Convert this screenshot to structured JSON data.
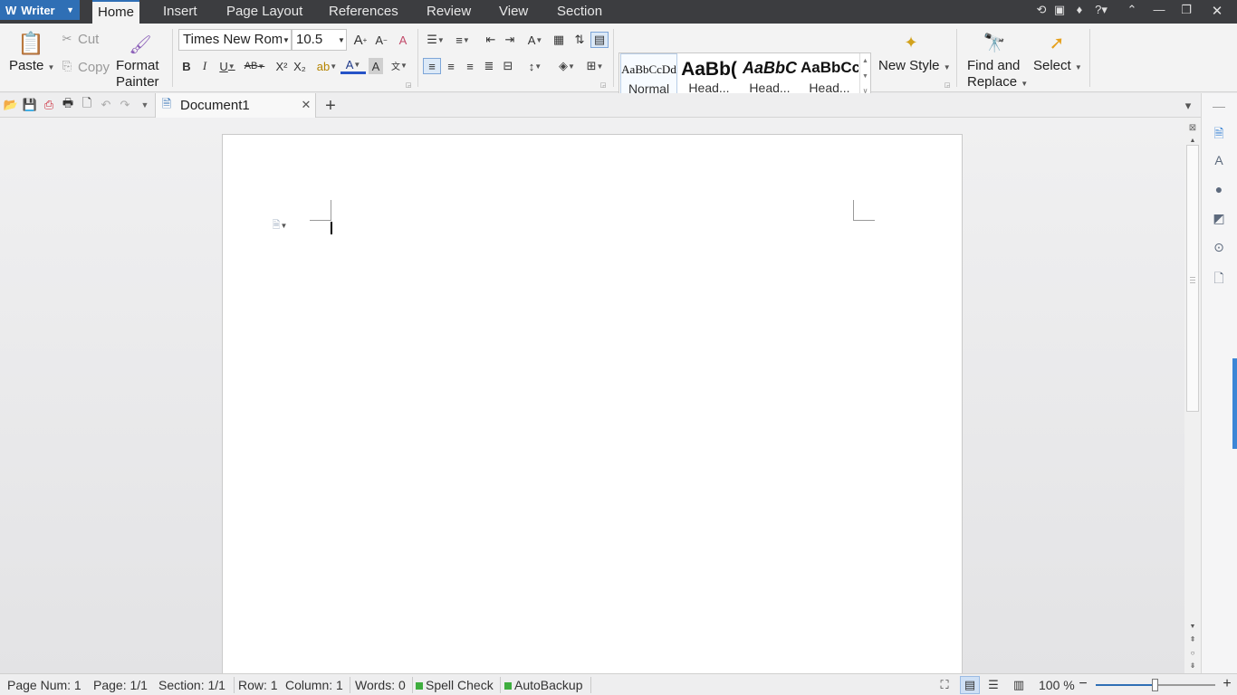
{
  "app": {
    "name": "Writer"
  },
  "menu": {
    "tabs": [
      "Home",
      "Insert",
      "Page Layout",
      "References",
      "Review",
      "View",
      "Section"
    ],
    "active": "Home"
  },
  "ribbon": {
    "paste": "Paste",
    "cut": "Cut",
    "copy": "Copy",
    "format_painter_1": "Format",
    "format_painter_2": "Painter",
    "font_name": "Times New Roman",
    "font_size": "10.5",
    "styles": [
      {
        "preview": "AaBbCcDd",
        "label": "Normal"
      },
      {
        "preview": "AaBb(",
        "label": "Head..."
      },
      {
        "preview": "AaBbC",
        "label": "Head..."
      },
      {
        "preview": "AaBbCc",
        "label": "Head..."
      }
    ],
    "new_style": "New Style",
    "find_replace_1": "Find and",
    "find_replace_2": "Replace",
    "select": "Select"
  },
  "tabs": {
    "document": "Document1"
  },
  "status": {
    "page_num": "Page Num: 1",
    "page": "Page: 1/1",
    "section": "Section: 1/1",
    "row": "Row: 1",
    "column": "Column: 1",
    "words": "Words: 0",
    "spell_check": "Spell Check",
    "auto_backup": "AutoBackup",
    "zoom": "100 %",
    "zoom_level": 0.5
  },
  "colors": {
    "accent": "#2f6fb5",
    "menubar": "#3c3d40",
    "status_green": "#3fae3f"
  }
}
